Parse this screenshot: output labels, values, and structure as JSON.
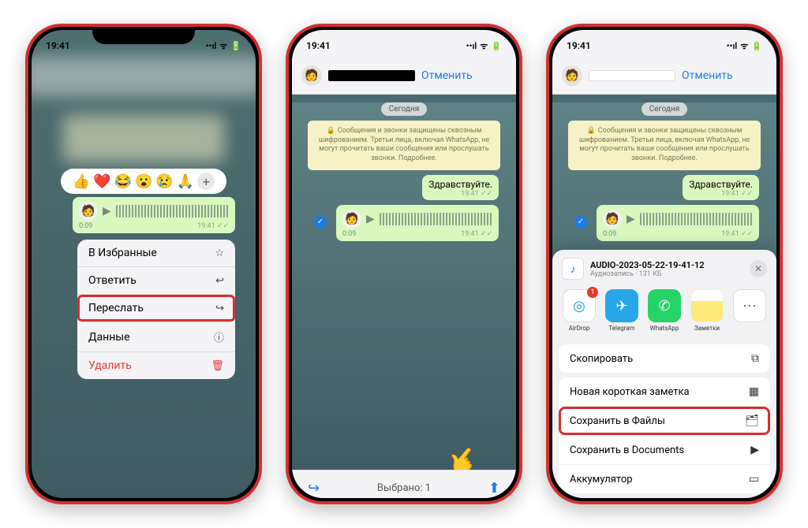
{
  "status": {
    "time": "19:41"
  },
  "reactions": [
    "👍",
    "❤️",
    "😂",
    "😮",
    "😢",
    "🙏"
  ],
  "voice": {
    "duration": "0:09",
    "time": "19:41",
    "ticks": "✓✓"
  },
  "context_menu": [
    {
      "label": "В Избранные",
      "icon": "☆",
      "danger": false,
      "highlight": false
    },
    {
      "label": "Ответить",
      "icon": "↩",
      "danger": false,
      "highlight": false
    },
    {
      "label": "Переслать",
      "icon": "↪",
      "danger": false,
      "highlight": true
    },
    {
      "label": "Данные",
      "icon": "ⓘ",
      "danger": false,
      "highlight": false
    },
    {
      "label": "Удалить",
      "icon": "🗑",
      "danger": true,
      "highlight": false
    }
  ],
  "chat": {
    "cancel": "Отменить",
    "day": "Сегодня",
    "encryption": "Сообщения и звонки защищены сквозным шифрованием. Третьи лица, включая WhatsApp, не могут прочитать ваши сообщения или прослушать звонки. Подробнее.",
    "greeting": "Здравствуйте.",
    "greeting_time": "19:41",
    "selected_footer": "Выбрано: 1"
  },
  "share": {
    "file_name": "AUDIO-2023-05-22-19-41-12",
    "file_sub": "Аудиозапись · 131 КБ",
    "apps": [
      {
        "label": "AirDrop",
        "cls": "airdrop",
        "glyph": "◎"
      },
      {
        "label": "Telegram",
        "cls": "tg",
        "glyph": "✈"
      },
      {
        "label": "WhatsApp",
        "cls": "wa",
        "glyph": "✆"
      },
      {
        "label": "Заметки",
        "cls": "notes",
        "glyph": ""
      },
      {
        "label": "",
        "cls": "more",
        "glyph": "⋯"
      }
    ],
    "actions_a": [
      {
        "label": "Скопировать",
        "icon": "⧉",
        "hl": false
      }
    ],
    "actions_b": [
      {
        "label": "Новая короткая заметка",
        "icon": "▦",
        "hl": false
      },
      {
        "label": "Сохранить в Файлы",
        "icon": "🗂",
        "hl": true
      },
      {
        "label": "Сохранить в Documents",
        "icon": "▶",
        "hl": false
      },
      {
        "label": "Аккумулятор",
        "icon": "▭",
        "hl": false
      }
    ]
  }
}
